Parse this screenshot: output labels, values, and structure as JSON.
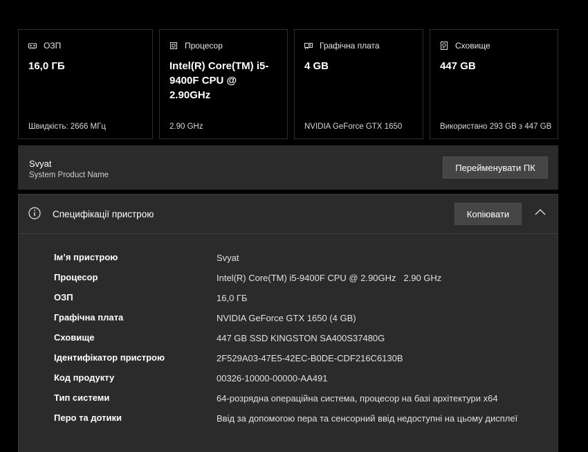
{
  "cards": [
    {
      "icon": "ram-icon",
      "label": "ОЗП",
      "value": "16,0 ГБ",
      "footer": "Швидкість: 2666 МГц"
    },
    {
      "icon": "cpu-icon",
      "label": "Процесор",
      "value": "Intel(R) Core(TM) i5-9400F CPU @ 2.90GHz",
      "footer": "2.90 GHz"
    },
    {
      "icon": "gpu-icon",
      "label": "Графічна плата",
      "value": "4 GB",
      "footer": "NVIDIA GeForce GTX 1650"
    },
    {
      "icon": "storage-icon",
      "label": "Сховище",
      "value": "447 GB",
      "footer": "Використано 293 GB з 447 GB"
    }
  ],
  "device": {
    "name": "Svyat",
    "model": "System Product Name",
    "rename_label": "Перейменувати ПК"
  },
  "specs": {
    "title": "Специфікації пристрою",
    "copy_label": "Копіювати",
    "rows": [
      {
        "key": "Ім’я пристрою",
        "value": "Svyat"
      },
      {
        "key": "Процесор",
        "value": "Intel(R) Core(TM) i5-9400F CPU @ 2.90GHz   2.90 GHz"
      },
      {
        "key": "ОЗП",
        "value": "16,0 ГБ"
      },
      {
        "key": "Графічна плата",
        "value": "NVIDIA GeForce GTX 1650 (4 GB)"
      },
      {
        "key": "Сховище",
        "value": "447 GB SSD KINGSTON SA400S37480G"
      },
      {
        "key": "Ідентифікатор пристрою",
        "value": "2F529A03-47E5-42EC-B0DE-CDF216C6130B"
      },
      {
        "key": "Код продукту",
        "value": "00326-10000-00000-AA491"
      },
      {
        "key": "Тип системи",
        "value": "64-розрядна операційна система, процесор на базі архітектури x64"
      },
      {
        "key": "Перо та дотики",
        "value": "Ввід за допомогою пера та сенсорний ввід недоступні на цьому дисплеї"
      }
    ]
  }
}
